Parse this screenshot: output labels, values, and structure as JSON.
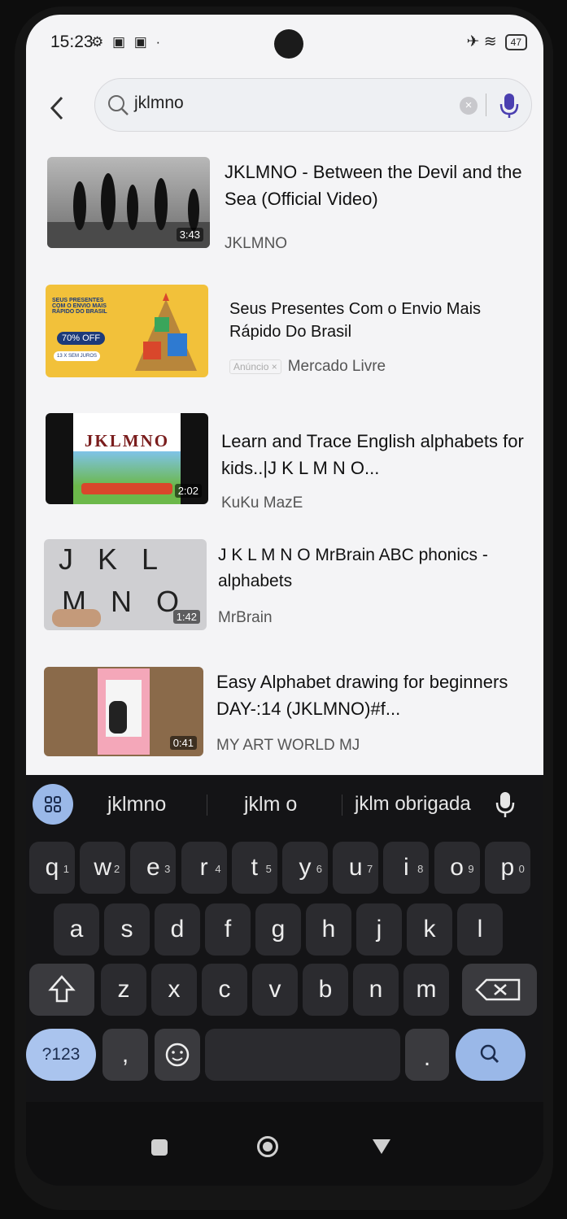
{
  "status": {
    "time": "15:23",
    "icons": "⚙ ▣ ▣ ·",
    "right_icons": "✈ ≋",
    "battery": "47"
  },
  "search": {
    "value": "jklmno"
  },
  "results": [
    {
      "title": "JKLMNO - Between the Devil and the Sea (Official Video)",
      "channel": "JKLMNO",
      "duration": "3:43"
    },
    {
      "title": "Seus Presentes Com o Envio Mais Rápido Do Brasil",
      "channel": "Mercado Livre",
      "ad_label": "Anúncio ×",
      "thumb_text": "SEUS PRESENTES COM O ENVIO MAIS RÁPIDO DO BRASIL",
      "thumb_badge": "70% OFF",
      "thumb_badge2": "13 X SEM JUROS"
    },
    {
      "title": "Learn and Trace English alphabets for kids..|J K L M N O...",
      "channel": "KuKu MazE",
      "duration": "2:02",
      "thumb_text": "JKLMNO"
    },
    {
      "title": "J K L M N O MrBrain ABC phonics - alphabets",
      "channel": "MrBrain",
      "duration": "1:42",
      "thumb_text_top": "J  K  L",
      "thumb_text_bottom": "M  N  O"
    },
    {
      "title": "Easy Alphabet drawing for beginners DAY-:14 (JKLMNO)#f...",
      "channel": "MY ART WORLD MJ",
      "duration": "0:41"
    }
  ],
  "keyboard": {
    "suggestions": [
      "jklmno",
      "jklm o",
      "jklm obrigada"
    ],
    "row1": [
      {
        "k": "q",
        "n": "1"
      },
      {
        "k": "w",
        "n": "2"
      },
      {
        "k": "e",
        "n": "3"
      },
      {
        "k": "r",
        "n": "4"
      },
      {
        "k": "t",
        "n": "5"
      },
      {
        "k": "y",
        "n": "6"
      },
      {
        "k": "u",
        "n": "7"
      },
      {
        "k": "i",
        "n": "8"
      },
      {
        "k": "o",
        "n": "9"
      },
      {
        "k": "p",
        "n": "0"
      }
    ],
    "row2": [
      "a",
      "s",
      "d",
      "f",
      "g",
      "h",
      "j",
      "k",
      "l"
    ],
    "row3": [
      "z",
      "x",
      "c",
      "v",
      "b",
      "n",
      "m"
    ],
    "sym_label": "?123",
    "comma": ",",
    "period": "."
  },
  "colors": {
    "accent": "#9ab8e8",
    "app_bg": "#f4f4f6",
    "key_bg": "#2b2b2f"
  }
}
